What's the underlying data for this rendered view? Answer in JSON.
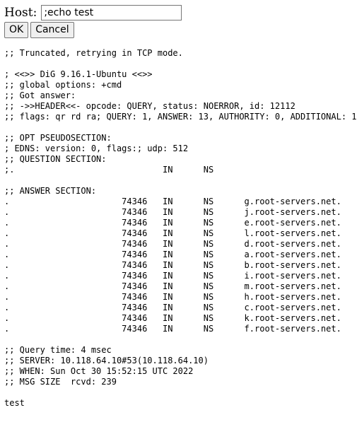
{
  "form": {
    "host_label": "Host:",
    "host_value": ";echo test",
    "ok_label": "OK",
    "cancel_label": "Cancel"
  },
  "output": {
    "lines": [
      ";; Truncated, retrying in TCP mode.",
      "",
      "; <<>> DiG 9.16.1-Ubuntu <<>>",
      ";; global options: +cmd",
      ";; Got answer:",
      ";; ->>HEADER<<- opcode: QUERY, status: NOERROR, id: 12112",
      ";; flags: qr rd ra; QUERY: 1, ANSWER: 13, AUTHORITY: 0, ADDITIONAL: 1",
      "",
      ";; OPT PSEUDOSECTION:",
      "; EDNS: version: 0, flags:; udp: 512",
      ";; QUESTION SECTION:",
      ";.                             IN      NS",
      "",
      ";; ANSWER SECTION:",
      ".                      74346   IN      NS      g.root-servers.net.",
      ".                      74346   IN      NS      j.root-servers.net.",
      ".                      74346   IN      NS      e.root-servers.net.",
      ".                      74346   IN      NS      l.root-servers.net.",
      ".                      74346   IN      NS      d.root-servers.net.",
      ".                      74346   IN      NS      a.root-servers.net.",
      ".                      74346   IN      NS      b.root-servers.net.",
      ".                      74346   IN      NS      i.root-servers.net.",
      ".                      74346   IN      NS      m.root-servers.net.",
      ".                      74346   IN      NS      h.root-servers.net.",
      ".                      74346   IN      NS      c.root-servers.net.",
      ".                      74346   IN      NS      k.root-servers.net.",
      ".                      74346   IN      NS      f.root-servers.net.",
      "",
      ";; Query time: 4 msec",
      ";; SERVER: 10.118.64.10#53(10.118.64.10)",
      ";; WHEN: Sun Oct 30 15:52:15 UTC 2022",
      ";; MSG SIZE  rcvd: 239"
    ],
    "trailing": "test"
  }
}
